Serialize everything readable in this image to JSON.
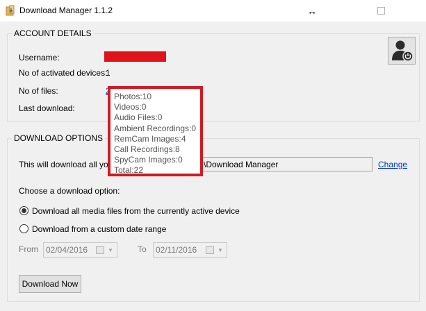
{
  "window": {
    "title": "Download Manager 1.1.2",
    "resize_glyph": "↔"
  },
  "account_details": {
    "legend": "ACCOUNT DETAILS",
    "username_label": "Username:",
    "username_value": "",
    "activated_devices_label": "No of activated devices:",
    "activated_devices_value": "1",
    "files_label": "No of files:",
    "files_value": "2",
    "last_download_label": "Last download:",
    "power_icon": "user-power-icon"
  },
  "tooltip": {
    "lines": [
      "Photos:10",
      "Videos:0",
      "Audio Files:0",
      "Ambient Recordings:0",
      "RemCam Images:4",
      "Call Recordings:8",
      "SpyCam Images:0",
      "Total:22"
    ]
  },
  "download_options": {
    "legend": "DOWNLOAD OPTIONS",
    "description_prefix": "This will download all your m",
    "path_value": "\\Download Manager",
    "change_link": "Change",
    "choose_label": "Choose a download option:",
    "option_all": "Download all media files from the currently active device",
    "option_all_selected": true,
    "option_range": "Download from a custom date range",
    "from_label": "From",
    "from_date": "02/04/2016",
    "to_label": "To",
    "to_date": "02/11/2016",
    "download_button": "Download Now"
  },
  "colors": {
    "accent_red": "#d11a22",
    "link_blue": "#0033cc",
    "window_bg": "#f0f0f0"
  }
}
